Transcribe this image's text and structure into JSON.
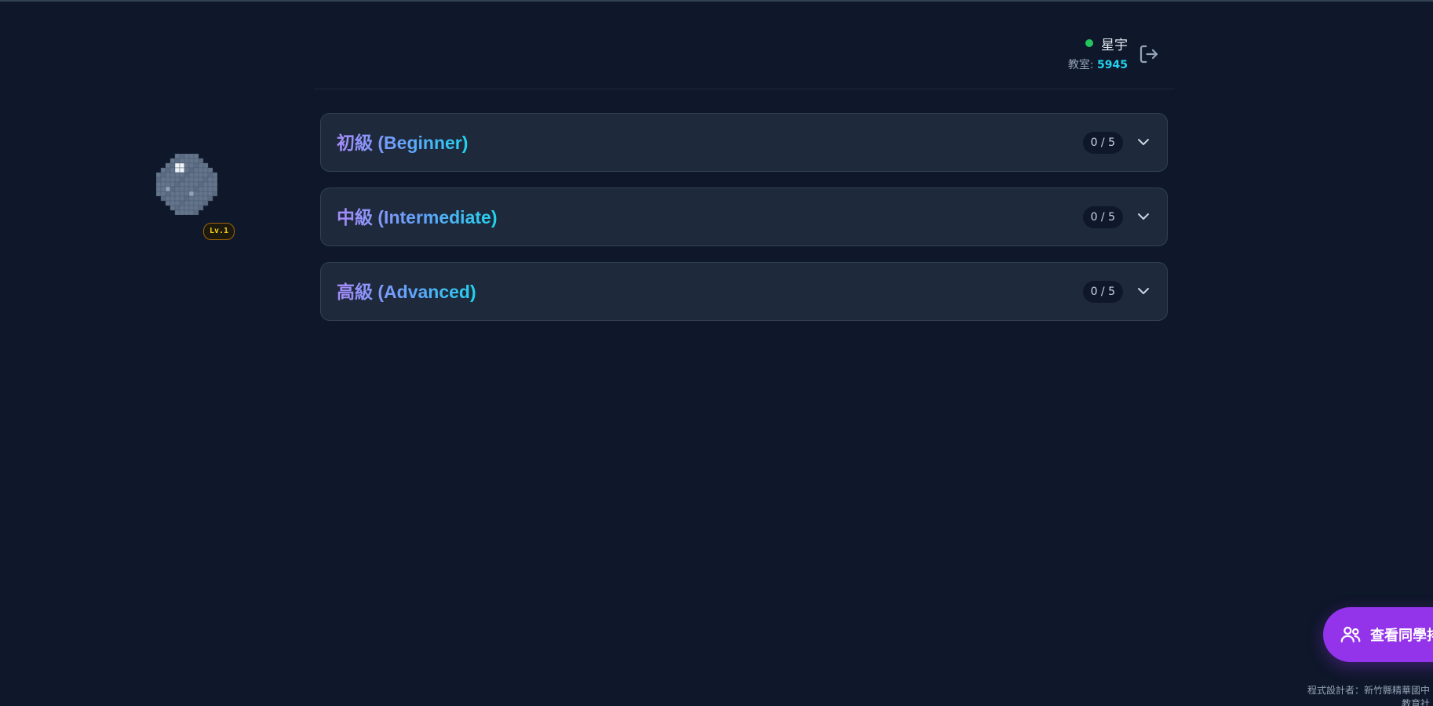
{
  "header": {
    "user_name": "星宇",
    "room_label": "教室: ",
    "room_number": "5945",
    "online_status_color": "#22c55e",
    "logout_icon": "logout-icon"
  },
  "avatar": {
    "icon": "pixel-planet-avatar",
    "level_badge": "Lv.1"
  },
  "levels": [
    {
      "title": "初級 (Beginner)",
      "progress": "0 / 5",
      "expanded": false
    },
    {
      "title": "中級 (Intermediate)",
      "progress": "0 / 5",
      "expanded": false
    },
    {
      "title": "高級 (Advanced)",
      "progress": "0 / 5",
      "expanded": false
    }
  ],
  "fab": {
    "icon": "users-icon",
    "label": "查看同學排",
    "color": "#9333ea"
  },
  "footer": {
    "credit_line1": "程式設計者：新竹縣精華國中",
    "credit_line2": "教育社"
  },
  "colors": {
    "background": "#0f172a",
    "card": "#1e293b",
    "accent_cyan": "#22d3ee",
    "accent_purple": "#a78bfa"
  }
}
